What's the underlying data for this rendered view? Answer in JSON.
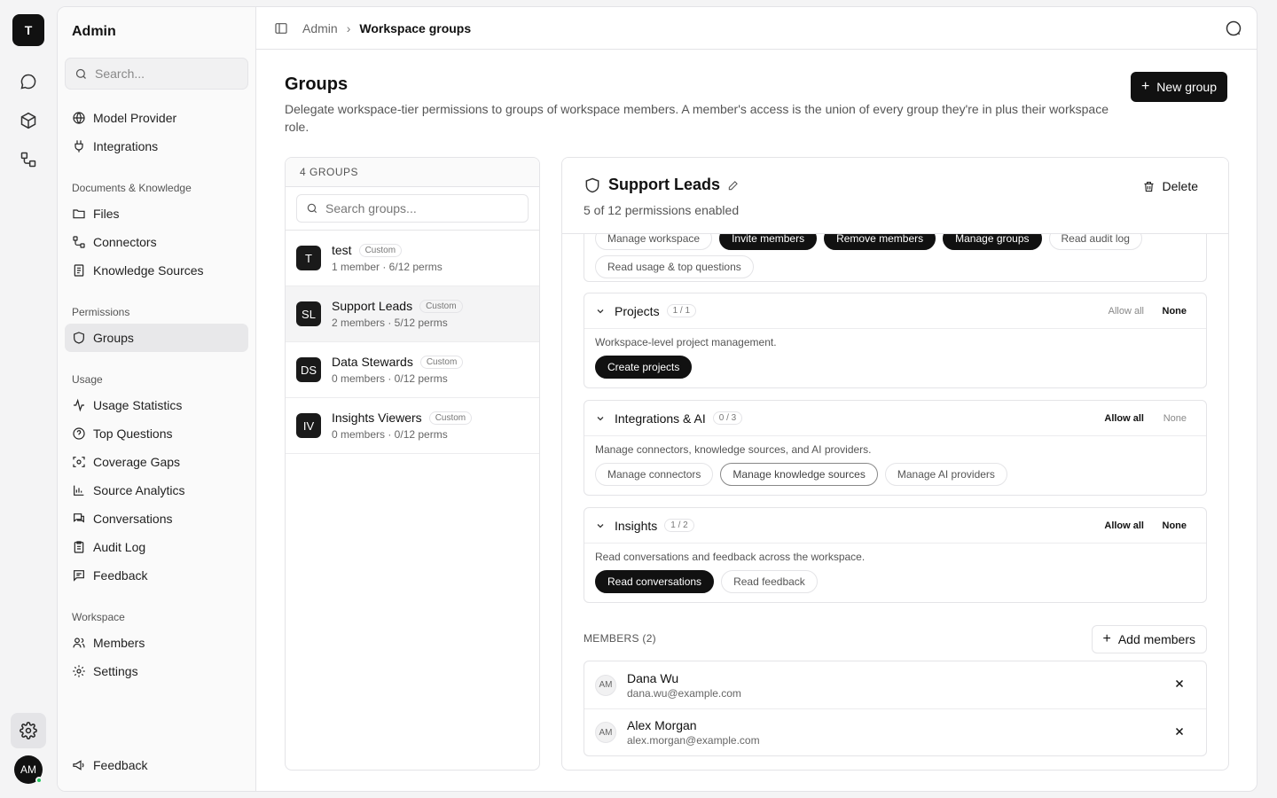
{
  "rail": {
    "logo": "T",
    "avatar": "AM"
  },
  "sidebar": {
    "title": "Admin",
    "search_placeholder": "Search...",
    "top_items": [
      {
        "label": "Model Provider",
        "icon": "globe-icon"
      },
      {
        "label": "Integrations",
        "icon": "plug-icon"
      }
    ],
    "sections": [
      {
        "title": "Documents & Knowledge",
        "items": [
          {
            "label": "Files",
            "icon": "folder-icon"
          },
          {
            "label": "Connectors",
            "icon": "connector-icon"
          },
          {
            "label": "Knowledge Sources",
            "icon": "book-icon"
          }
        ]
      },
      {
        "title": "Permissions",
        "items": [
          {
            "label": "Groups",
            "icon": "shield-icon",
            "active": true
          }
        ]
      },
      {
        "title": "Usage",
        "items": [
          {
            "label": "Usage Statistics",
            "icon": "activity-icon"
          },
          {
            "label": "Top Questions",
            "icon": "question-icon"
          },
          {
            "label": "Coverage Gaps",
            "icon": "scan-icon"
          },
          {
            "label": "Source Analytics",
            "icon": "bar-chart-icon"
          },
          {
            "label": "Conversations",
            "icon": "chat-icon"
          },
          {
            "label": "Audit Log",
            "icon": "clipboard-icon"
          },
          {
            "label": "Feedback",
            "icon": "message-icon"
          }
        ]
      },
      {
        "title": "Workspace",
        "items": [
          {
            "label": "Members",
            "icon": "users-icon"
          },
          {
            "label": "Settings",
            "icon": "gear-icon"
          }
        ]
      }
    ],
    "footer_feedback": "Feedback"
  },
  "breadcrumb": {
    "parent": "Admin",
    "current": "Workspace groups"
  },
  "page": {
    "title": "Groups",
    "description": "Delegate workspace-tier permissions to groups of workspace members. A member's access is the union of every group they're in plus their workspace role.",
    "new_group_label": "New group"
  },
  "groups": {
    "header": "4 GROUPS",
    "search_placeholder": "Search groups...",
    "items": [
      {
        "avatar": "T",
        "name": "test",
        "badge": "Custom",
        "meta": "1 member · 6/12 perms"
      },
      {
        "avatar": "SL",
        "name": "Support Leads",
        "badge": "Custom",
        "meta": "2 members · 5/12 perms",
        "active": true
      },
      {
        "avatar": "DS",
        "name": "Data Stewards",
        "badge": "Custom",
        "meta": "0 members · 0/12 perms"
      },
      {
        "avatar": "IV",
        "name": "Insights Viewers",
        "badge": "Custom",
        "meta": "0 members · 0/12 perms"
      }
    ]
  },
  "detail": {
    "title": "Support Leads",
    "subtitle": "5 of 12 permissions enabled",
    "delete_label": "Delete",
    "partial_chips": [
      "Manage workspace",
      "Invite members",
      "Remove members",
      "Manage groups",
      "Read audit log"
    ],
    "partial_last_chip": "Read usage & top questions",
    "categories": [
      {
        "name": "Projects",
        "count": "1 / 1",
        "allow": "Allow all",
        "none": "None",
        "desc": "Workspace-level project management.",
        "chips": [
          {
            "label": "Create projects",
            "selected": true
          }
        ]
      },
      {
        "name": "Integrations & AI",
        "count": "0 / 3",
        "allow": "Allow all",
        "none": "None",
        "desc": "Manage connectors, knowledge sources, and AI providers.",
        "chips": [
          {
            "label": "Manage connectors",
            "selected": false
          },
          {
            "label": "Manage knowledge sources",
            "selected": false
          },
          {
            "label": "Manage AI providers",
            "selected": false
          }
        ]
      },
      {
        "name": "Insights",
        "count": "1 / 2",
        "allow": "Allow all",
        "none": "None",
        "desc": "Read conversations and feedback across the workspace.",
        "chips": [
          {
            "label": "Read conversations",
            "selected": true
          },
          {
            "label": "Read feedback",
            "selected": false
          }
        ]
      }
    ],
    "members_title": "MEMBERS (2)",
    "add_members_label": "Add members",
    "members": [
      {
        "avatar": "AM",
        "name": "Dana Wu",
        "email": "dana.wu@example.com"
      },
      {
        "avatar": "AM",
        "name": "Alex Morgan",
        "email": "alex.morgan@example.com"
      }
    ]
  }
}
